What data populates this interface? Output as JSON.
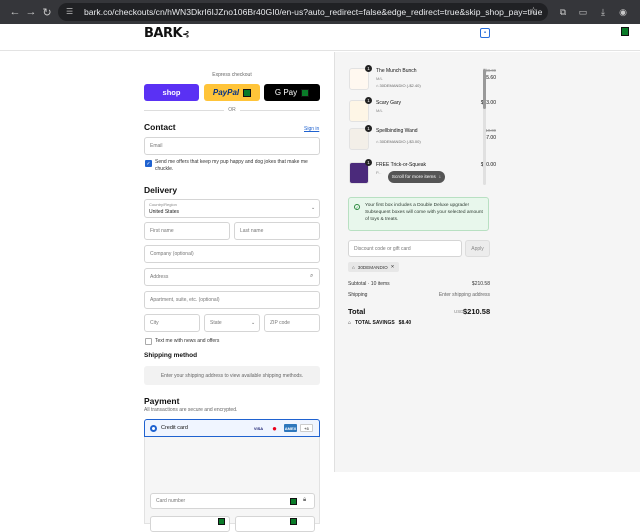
{
  "browser": {
    "url": "bark.co/checkouts/cn/hWN3DkrI6IJZno106Br40GI0/en-us?auto_redirect=false&edge_redirect=true&skip_shop_pay=true"
  },
  "header": {
    "logo": "BARK",
    "cart_icon": "bag-icon"
  },
  "express": {
    "label": "Express checkout",
    "shop_label": "shop",
    "paypal_label": "PayPal",
    "gpay_label": "G Pay",
    "or_label": "OR"
  },
  "contact": {
    "title": "Contact",
    "sign_in": "Sign in",
    "email_placeholder": "Email",
    "offers_text": "Send me offers that keep my pup happy and dog jokes that make me chuckle."
  },
  "delivery": {
    "title": "Delivery",
    "country_label": "Country/Region",
    "country_value": "United States",
    "first_name": "First name",
    "last_name": "Last name",
    "company": "Company (optional)",
    "address": "Address",
    "apartment": "Apartment, suite, etc. (optional)",
    "city": "City",
    "state": "State",
    "zip": "ZIP code",
    "text_me": "Text me with news and offers"
  },
  "shipping": {
    "title": "Shipping method",
    "message": "Enter your shipping address to view available shipping methods."
  },
  "payment": {
    "title": "Payment",
    "subtitle": "All transactions are secure and encrypted.",
    "credit_card": "Credit card",
    "cards": [
      "VISA",
      "MC",
      "AMEX",
      "+3"
    ],
    "card_number": "Card number"
  },
  "order": {
    "items": [
      {
        "qty": "1",
        "name": "The Munch Bunch",
        "sub": "M/L",
        "tag": "30DEMANDIO (-$2.40)",
        "old_price": "$8.00",
        "price": "$5.60"
      },
      {
        "qty": "1",
        "name": "Scary Gary",
        "sub": "M/L",
        "tag": "",
        "old_price": "",
        "price": "$13.00"
      },
      {
        "qty": "1",
        "name": "Spellbinding Wand",
        "sub": "",
        "tag": "30DEMANDIO (-$3.00)",
        "old_price": "$10.00",
        "price": "$7.00"
      },
      {
        "qty": "1",
        "name": "FREE Trick-or-Squeak",
        "sub": "P...",
        "tag": "",
        "old_price": "",
        "price": "$10.00"
      }
    ],
    "scroll_pill": "Scroll for more items",
    "notice": "Your first box includes a Double Deluxe upgrade! Subsequent boxes will come with your selected amount of toys & treats.",
    "discount_placeholder": "Discount code or gift card",
    "apply": "Apply",
    "code": "30DEMANDIO",
    "subtotal_label": "Subtotal · 10 items",
    "subtotal_value": "$210.58",
    "shipping_label": "Shipping",
    "shipping_value": "Enter shipping address",
    "total_label": "Total",
    "currency": "USD",
    "total_value": "$210.58",
    "savings_label": "TOTAL SAVINGS",
    "savings_value": "$8.40"
  },
  "colors": {
    "shop": "#5a31f4",
    "paypal": "#ffc439",
    "link": "#1f62d0",
    "notice": "#e8f7ec"
  }
}
